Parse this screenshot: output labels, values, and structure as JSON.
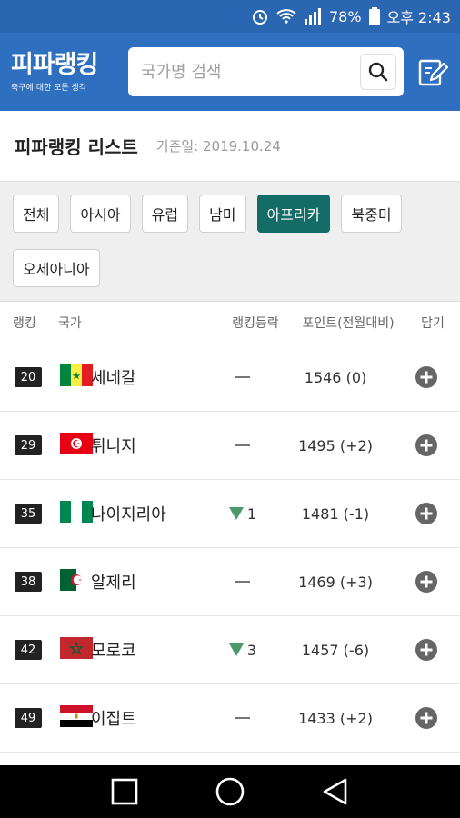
{
  "statusbar": {
    "battery": "78%",
    "time": "오후 2:43"
  },
  "header": {
    "logo_title": "피파랭킹",
    "logo_subtitle": "축구에 대한 모든 생각",
    "search_placeholder": "국가명 검색"
  },
  "page": {
    "title": "피파랭킹 리스트",
    "date_label": "기준일: 2019.10.24"
  },
  "filters": [
    {
      "label": "전체",
      "active": false
    },
    {
      "label": "아시아",
      "active": false
    },
    {
      "label": "유럽",
      "active": false
    },
    {
      "label": "남미",
      "active": false
    },
    {
      "label": "아프리카",
      "active": true
    },
    {
      "label": "북중미",
      "active": false
    },
    {
      "label": "오세아니아",
      "active": false
    }
  ],
  "table": {
    "headers": {
      "rank": "랭킹",
      "country": "국가",
      "change": "랭킹등락",
      "points": "포인트(전월대비)",
      "add": "담기"
    },
    "rows": [
      {
        "rank": "20",
        "country": "세네갈",
        "change": "",
        "points": "1546 (0)",
        "flag": "senegal"
      },
      {
        "rank": "29",
        "country": "튀니지",
        "change": "",
        "points": "1495 (+2)",
        "flag": "tunisia"
      },
      {
        "rank": "35",
        "country": "나이지리아",
        "change": "1",
        "points": "1481 (-1)",
        "flag": "nigeria"
      },
      {
        "rank": "38",
        "country": "알제리",
        "change": "",
        "points": "1469 (+3)",
        "flag": "algeria"
      },
      {
        "rank": "42",
        "country": "모로코",
        "change": "3",
        "points": "1457 (-6)",
        "flag": "morocco"
      },
      {
        "rank": "49",
        "country": "이집트",
        "change": "",
        "points": "1433 (+2)",
        "flag": "egypt"
      }
    ]
  },
  "colors": {
    "brand": "#2f6fbf",
    "active_chip": "#136d66",
    "change_down": "#4c9a6c"
  }
}
